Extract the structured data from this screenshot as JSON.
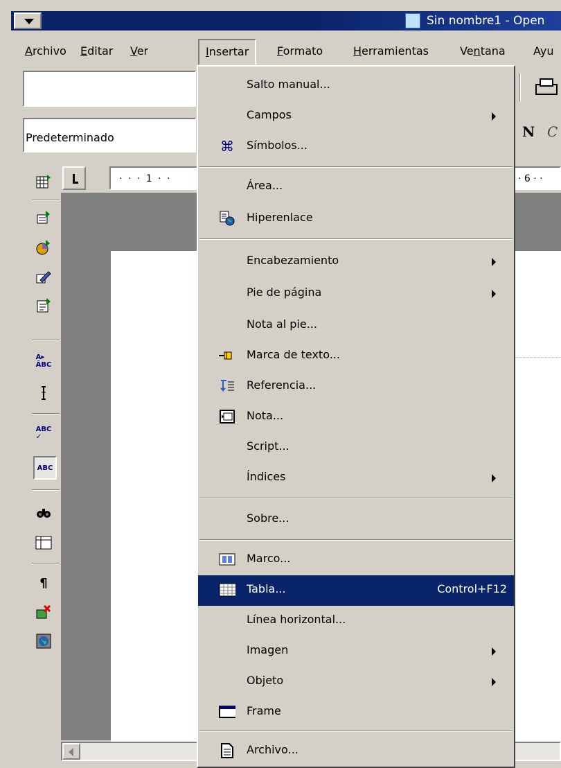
{
  "window": {
    "title": "Sin nombre1 - Open"
  },
  "menubar": [
    "Archivo",
    "Editar",
    "Ver",
    "Insertar",
    "Formato",
    "Herramientas",
    "Ventana",
    "Ayu"
  ],
  "toolbar": {
    "style_value": "Predeterminado",
    "bold_label": "N",
    "italic_label": "C"
  },
  "ruler": {
    "left_text": "· · · 1 · ·",
    "right_text": "· 6 · ·"
  },
  "insert_menu": {
    "items": {
      "salto": "Salto manual...",
      "campos": "Campos",
      "simbolos": "Símbolos...",
      "area": "Área...",
      "hiperenlace": "Hiperenlace",
      "encabezamiento": "Encabezamiento",
      "pie": "Pie de página",
      "nota_pie": "Nota al pie...",
      "marca": "Marca de texto...",
      "referencia": "Referencia...",
      "nota": "Nota...",
      "script": "Script...",
      "indices": "Índices",
      "sobre": "Sobre...",
      "marco": "Marco...",
      "tabla": "Tabla...",
      "tabla_shortcut": "Control+F12",
      "linea": "Línea horizontal...",
      "imagen": "Imagen",
      "objeto": "Objeto",
      "frame": "Frame",
      "archivo": "Archivo..."
    },
    "highlighted": "Tabla..."
  },
  "colors": {
    "titlebar": "#0a246a",
    "highlight": "#0a246a",
    "chrome": "#d4d0c8"
  }
}
